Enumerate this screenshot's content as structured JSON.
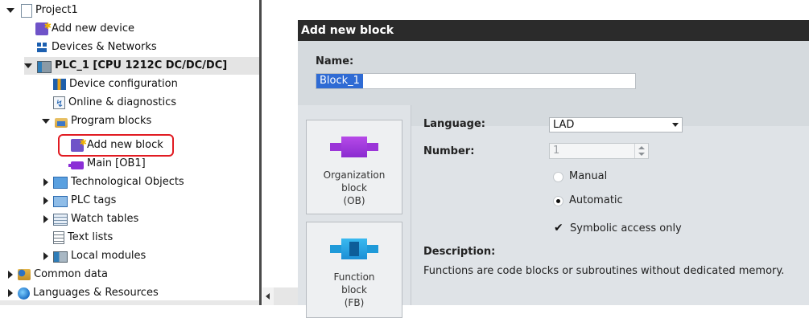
{
  "tree": {
    "items": [
      {
        "label": "Project1",
        "icon": "project-icon"
      },
      {
        "label": "Add new device",
        "icon": "add-device-icon"
      },
      {
        "label": "Devices & Networks",
        "icon": "network-icon"
      },
      {
        "label": "PLC_1 [CPU 1212C DC/DC/DC]",
        "icon": "plc-icon"
      },
      {
        "label": "Device configuration",
        "icon": "device-config-icon"
      },
      {
        "label": "Online & diagnostics",
        "icon": "diagnostics-icon"
      },
      {
        "label": "Program blocks",
        "icon": "folder-icon"
      },
      {
        "label": "Add new block",
        "icon": "add-block-icon"
      },
      {
        "label": "Main [OB1]",
        "icon": "ob-block-icon"
      },
      {
        "label": "Technological Objects",
        "icon": "tech-objects-icon"
      },
      {
        "label": "PLC tags",
        "icon": "plc-tags-icon"
      },
      {
        "label": "Watch tables",
        "icon": "watch-table-icon"
      },
      {
        "label": "Text lists",
        "icon": "text-list-icon"
      },
      {
        "label": "Local modules",
        "icon": "local-modules-icon"
      },
      {
        "label": "Common data",
        "icon": "common-data-icon"
      },
      {
        "label": "Languages & Resources",
        "icon": "languages-icon"
      }
    ],
    "highlight_color": "#e11b22"
  },
  "dialog": {
    "title": "Add new block",
    "name_label": "Name:",
    "name_value": "Block_1",
    "blocks": [
      {
        "line1": "Organization",
        "line2": "block",
        "line3": "(OB)"
      },
      {
        "line1": "Function",
        "line2": "block",
        "line3": "(FB)"
      }
    ],
    "language_label": "Language:",
    "language_value": "LAD",
    "number_label": "Number:",
    "number_value": "1",
    "manual_label": "Manual",
    "automatic_label": "Automatic",
    "symbolic_label": "Symbolic access only",
    "description_label": "Description:",
    "description_text": "Functions are code blocks or subroutines without dedicated memory.",
    "numbering_mode": "Automatic",
    "symbolic_checked": true
  },
  "colors": {
    "title_bar": "#2b2b2b",
    "dialog_bg": "#dfe3e7",
    "selection": "#2f6bd4",
    "ob_purple": "#8a2bd0",
    "fb_blue": "#1c8fd6"
  }
}
